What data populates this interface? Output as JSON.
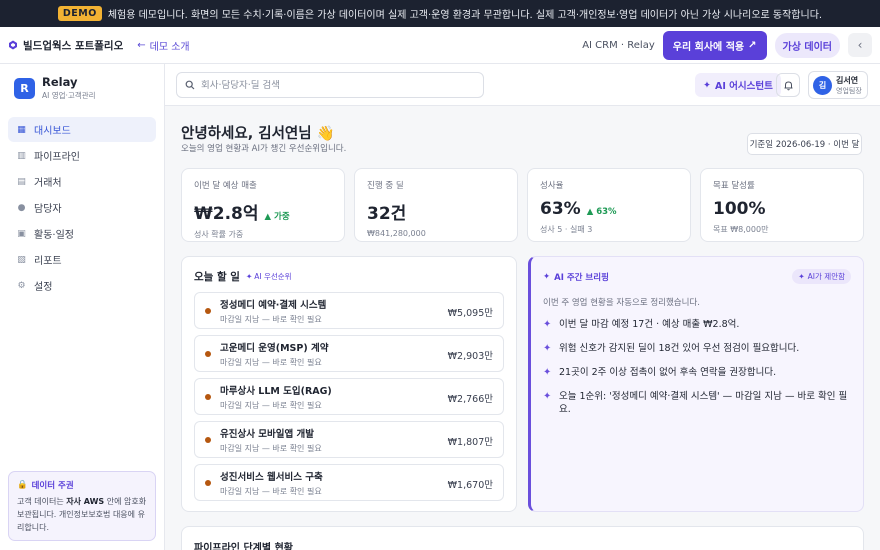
{
  "banner": {
    "badge": "DEMO",
    "text": "체험용 데모입니다. 화면의 모든 수치·기록·이름은 가상 데이터이며 실제 고객·운영 환경과 무관합니다. 실제 고객·개인정보·영업 데이터가 아닌 가상 시나리오로 동작합니다."
  },
  "topbar": {
    "brand": "빌드업웍스 포트폴리오",
    "back_link": "데모 소개",
    "crm_label": "AI CRM · Relay",
    "apply_button": "우리 회사에 적용",
    "virtual_pill": "가상 데이터"
  },
  "sidebar": {
    "app_initial": "R",
    "app_name": "Relay",
    "app_sub": "AI 영업·고객관리",
    "items": [
      {
        "label": "대시보드",
        "icon": "dashboard-icon",
        "active": true
      },
      {
        "label": "파이프라인",
        "icon": "pipeline-icon",
        "active": false
      },
      {
        "label": "거래처",
        "icon": "building-icon",
        "active": false
      },
      {
        "label": "담당자",
        "icon": "person-icon",
        "active": false
      },
      {
        "label": "활동·일정",
        "icon": "calendar-icon",
        "active": false
      },
      {
        "label": "리포트",
        "icon": "chart-icon",
        "active": false
      },
      {
        "label": "설정",
        "icon": "gear-icon",
        "active": false
      }
    ],
    "data_card": {
      "title": "데이터 주권",
      "body_pre": "고객 데이터는 ",
      "body_bold": "자사 AWS",
      "body_post": " 안에 암호화 보관됩니다. 개인정보보호법 대응에 유리합니다."
    }
  },
  "header": {
    "search_placeholder": "회사·담당자·딜 검색",
    "ai_button": "AI 어시스턴트",
    "user_initial": "김",
    "user_name": "김서연",
    "user_role": "영업팀장"
  },
  "dashboard": {
    "greeting": "안녕하세요, 김서연님 👋",
    "greeting_sub": "오늘의 영업 현황과 AI가 챙긴 우선순위입니다.",
    "date_label": "기준일 2026-06-19 · 이번 달",
    "kpis": [
      {
        "label": "이번 달 예상 매출",
        "value": "₩2.8억",
        "trend": "▲ 가중",
        "sub": "성사 확률 가중"
      },
      {
        "label": "진행 중 딜",
        "value": "32건",
        "trend": "",
        "sub": "₩841,280,000"
      },
      {
        "label": "성사율",
        "value": "63%",
        "trend": "▲ 63%",
        "sub": "성사 5 · 실패 3"
      },
      {
        "label": "목표 달성률",
        "value": "100%",
        "trend": "",
        "sub": "목표 ₩8,000만"
      }
    ],
    "todo": {
      "title": "오늘 할 일",
      "tag": "AI 우선순위",
      "items": [
        {
          "name": "정성메디 예약·결제 시스템",
          "note": "마감일 지남 — 바로 확인 필요",
          "amount": "₩5,095만"
        },
        {
          "name": "고운메디 운영(MSP) 계약",
          "note": "마감일 지남 — 바로 확인 필요",
          "amount": "₩2,903만"
        },
        {
          "name": "마루상사 LLM 도입(RAG)",
          "note": "마감일 지남 — 바로 확인 필요",
          "amount": "₩2,766만"
        },
        {
          "name": "유진상사 모바일앱 개발",
          "note": "마감일 지남 — 바로 확인 필요",
          "amount": "₩1,807만"
        },
        {
          "name": "성진서비스 웹서비스 구축",
          "note": "마감일 지남 — 바로 확인 필요",
          "amount": "₩1,670만"
        }
      ]
    },
    "brief": {
      "title": "AI 주간 브리핑",
      "tag": "AI가 제안함",
      "sub": "이번 주 영업 현황을 자동으로 정리했습니다.",
      "items": [
        "이번 달 마감 예정 17건 · 예상 매출 ₩2.8억.",
        "위험 신호가 감지된 딜이 18건 있어 우선 점검이 필요합니다.",
        "21곳이 2주 이상 접촉이 없어 후속 연락을 권장합니다.",
        "오늘 1순위: '정성메디 예약·결제 시스템' — 마감일 지남 — 바로 확인 필요."
      ]
    },
    "pipeline_title": "파이프라인 단계별 현황"
  },
  "colors": {
    "accent": "#5a40d9",
    "primary_blue": "#2f62e6",
    "trend_green": "#1e9a55",
    "overdue_dot": "#b5570f"
  }
}
